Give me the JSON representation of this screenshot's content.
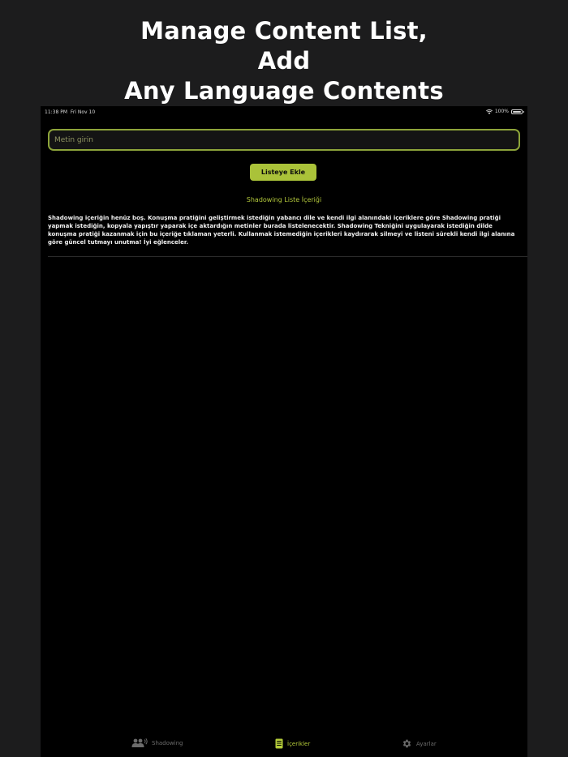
{
  "headline": {
    "line1": "Manage Content List,",
    "line2": "Add",
    "line3": "Any Language Contents"
  },
  "status_bar": {
    "time": "11:38 PM",
    "date": "Fri Nov 10",
    "battery": "100%"
  },
  "input": {
    "placeholder": "Metin girin",
    "value": ""
  },
  "add_button_label": "Listeye Ekle",
  "section_title": "Shadowing Liste İçeriği",
  "empty_message": "Shadowing içeriğin henüz boş. Konuşma pratiğini geliştirmek istediğin yabancı dile ve kendi ilgi alanındaki içeriklere göre Shadowing pratiği yapmak istediğin, kopyala yapıştır yaparak içe aktardığın metinler burada listelenecektir. Shadowing Tekniğini uygulayarak istediğin dilde konuşma pratiği kazanmak için bu içeriğe tıklaman yeterli. Kullanmak istemediğin içerikleri kaydırarak silmeyi ve listeni sürekli kendi ilgi alanına göre güncel tutmayı unutma! İyi eğlenceler.",
  "tabs": [
    {
      "label": "Shadowing",
      "icon": "people-speaking-icon",
      "active": false
    },
    {
      "label": "İçerikler",
      "icon": "document-list-icon",
      "active": true
    },
    {
      "label": "Ayarlar",
      "icon": "gear-icon",
      "active": false
    }
  ],
  "colors": {
    "accent": "#aac239",
    "background": "#000000",
    "frame": "#1c1c1d",
    "inactive_tab": "#6c6c6c"
  }
}
